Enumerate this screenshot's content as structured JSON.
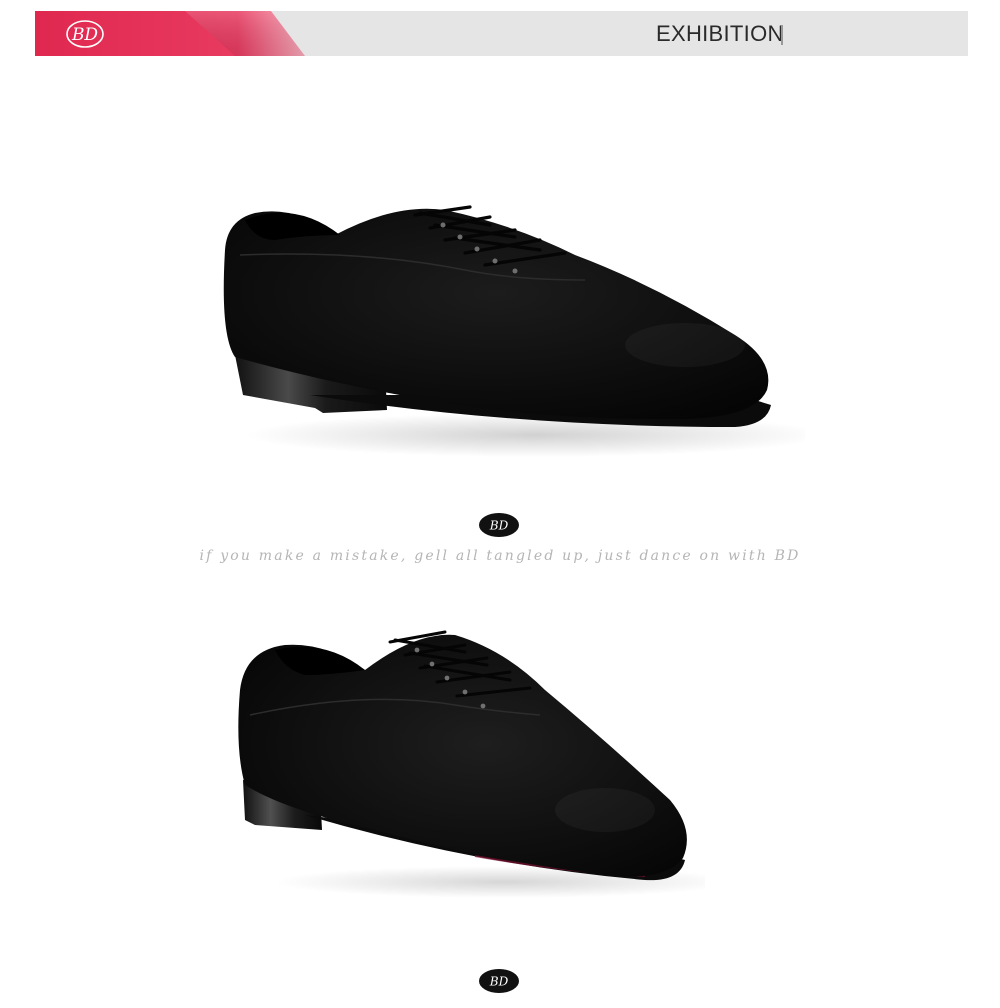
{
  "header": {
    "brand": "BD",
    "title": "EXHIBITION",
    "accent_color": "#e52a55",
    "bar_color": "#e5e5e5"
  },
  "gallery": {
    "photos": [
      {
        "subject": "black canvas lace-up men's latin dance shoe, side view"
      },
      {
        "subject": "black canvas lace-up men's latin dance shoe, three-quarter view"
      }
    ],
    "logo_mark": "BD",
    "tagline": "if you make a mistake, gell all tangled up, just dance on with BD"
  }
}
